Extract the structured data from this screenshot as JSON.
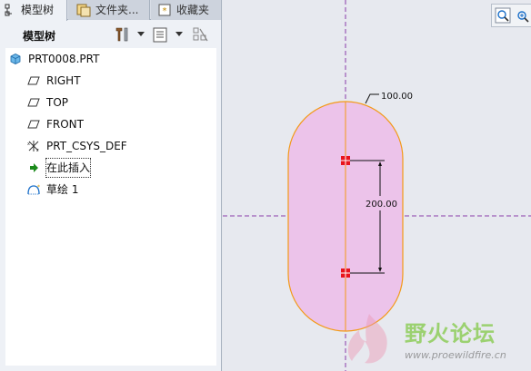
{
  "tabs": [
    {
      "label": "模型树",
      "icon": "model-tree-icon",
      "active": true
    },
    {
      "label": "文件夹...",
      "icon": "folder-browser-icon",
      "active": false
    },
    {
      "label": "收藏夹",
      "icon": "favorites-icon",
      "active": false
    }
  ],
  "toolbar": {
    "title": "模型树",
    "settings_icon": "tools-icon",
    "show_icon": "show-columns-icon",
    "filter_icon": "tree-filter-icon"
  },
  "tree": {
    "root": {
      "label": "PRT0008.PRT",
      "icon": "part-icon"
    },
    "items": [
      {
        "label": "RIGHT",
        "icon": "datum-plane-icon"
      },
      {
        "label": "TOP",
        "icon": "datum-plane-icon"
      },
      {
        "label": "FRONT",
        "icon": "datum-plane-icon"
      },
      {
        "label": "PRT_CSYS_DEF",
        "icon": "coordinate-system-icon"
      },
      {
        "label": "在此插入",
        "icon": "insert-here-arrow-icon"
      },
      {
        "label": "草绘 1",
        "icon": "sketch-icon"
      }
    ]
  },
  "canvas": {
    "dimension_radius": "100.00",
    "dimension_length": "200.00",
    "shape_fill": "#ecc3ea",
    "shape_stroke": "#f39a17",
    "axis_color": "#8a3aa8",
    "point_color": "#e8141c"
  },
  "watermark": {
    "title": "野火论坛",
    "url": "www.proewildfire.cn"
  },
  "colors": {
    "selection_accent": "#1a6fc9",
    "insert_arrow": "#1b8a1b"
  }
}
